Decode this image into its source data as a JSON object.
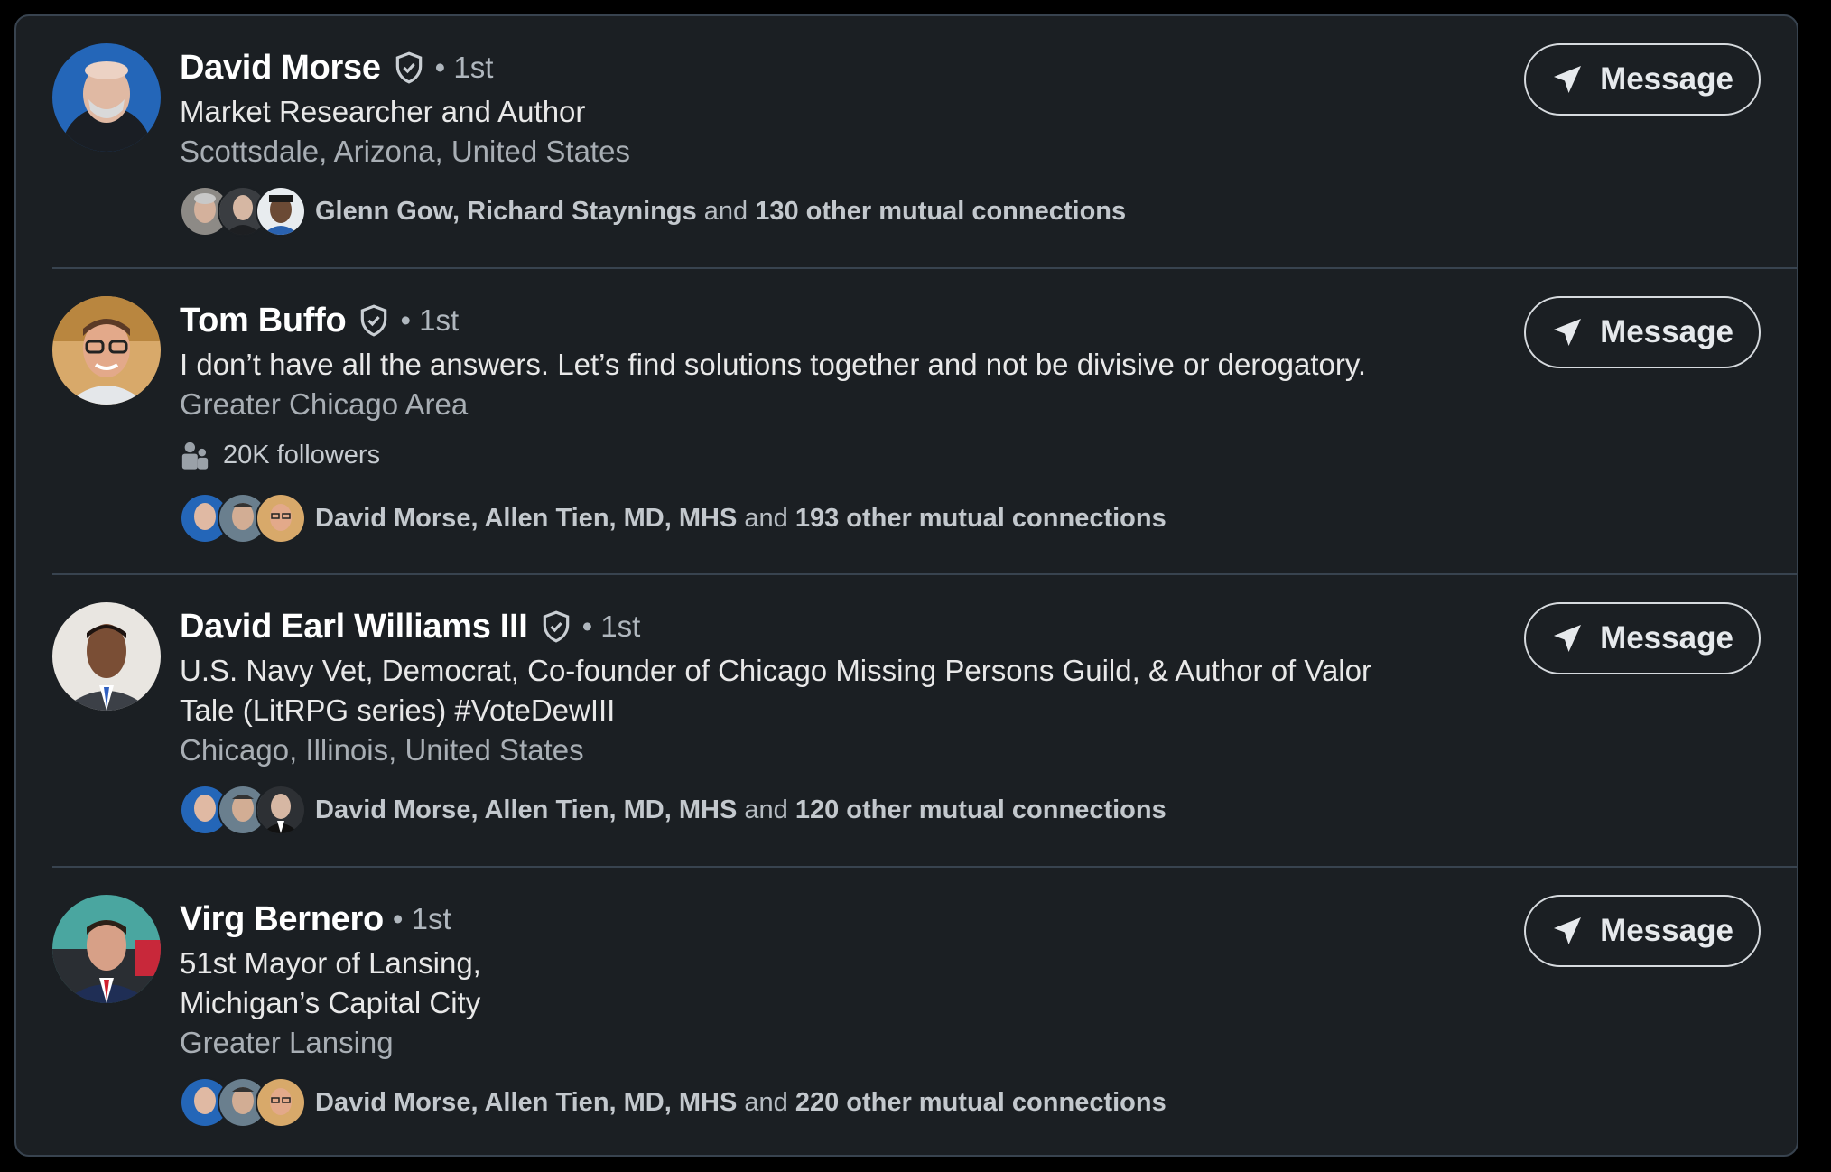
{
  "colors": {
    "panel_bg": "#1b1f23",
    "border": "#38434f",
    "text_primary": "#ffffff",
    "text_secondary": "#a8aeb4"
  },
  "connections": [
    {
      "name": "David Morse",
      "verified": true,
      "degree": "• 1st",
      "headline": "Market Researcher and Author",
      "location": "Scottsdale, Arizona, United States",
      "followers": "",
      "mutual": {
        "names": "Glenn Gow, Richard Staynings",
        "and": " and ",
        "others": "130 other mutual connections"
      },
      "message_label": "Message",
      "icons": {
        "avatar": "profile-photo",
        "verified": "verified-shield-icon",
        "message": "send-icon"
      }
    },
    {
      "name": "Tom Buffo",
      "verified": true,
      "degree": "• 1st",
      "headline": "I don’t have all the answers. Let’s find solutions together and not be divisive or derogatory.",
      "location": "Greater Chicago Area",
      "followers": "20K followers",
      "mutual": {
        "names": "David Morse, Allen Tien, MD, MHS",
        "and": " and ",
        "others": "193 other mutual connections"
      },
      "message_label": "Message",
      "icons": {
        "avatar": "profile-photo",
        "verified": "verified-shield-icon",
        "message": "send-icon",
        "followers": "people-icon"
      }
    },
    {
      "name": "David Earl Williams III",
      "verified": true,
      "degree": "• 1st",
      "headline_lines": [
        "U.S. Navy Vet, Democrat, Co-founder of Chicago Missing Persons Guild, & Author of Valor",
        "Tale (LitRPG series) #VoteDewIII"
      ],
      "location": "Chicago, Illinois, United States",
      "followers": "",
      "mutual": {
        "names": "David Morse, Allen Tien, MD, MHS",
        "and": " and ",
        "others": "120 other mutual connections"
      },
      "message_label": "Message",
      "icons": {
        "avatar": "profile-photo",
        "verified": "verified-shield-icon",
        "message": "send-icon"
      }
    },
    {
      "name": "Virg Bernero",
      "verified": false,
      "degree": "• 1st",
      "headline_lines": [
        "51st Mayor of Lansing,",
        "Michigan’s Capital City"
      ],
      "location": "Greater Lansing",
      "followers": "",
      "mutual": {
        "names": "David Morse, Allen Tien, MD, MHS",
        "and": " and ",
        "others": "220 other mutual connections"
      },
      "message_label": "Message",
      "icons": {
        "avatar": "profile-photo",
        "message": "send-icon"
      }
    }
  ]
}
